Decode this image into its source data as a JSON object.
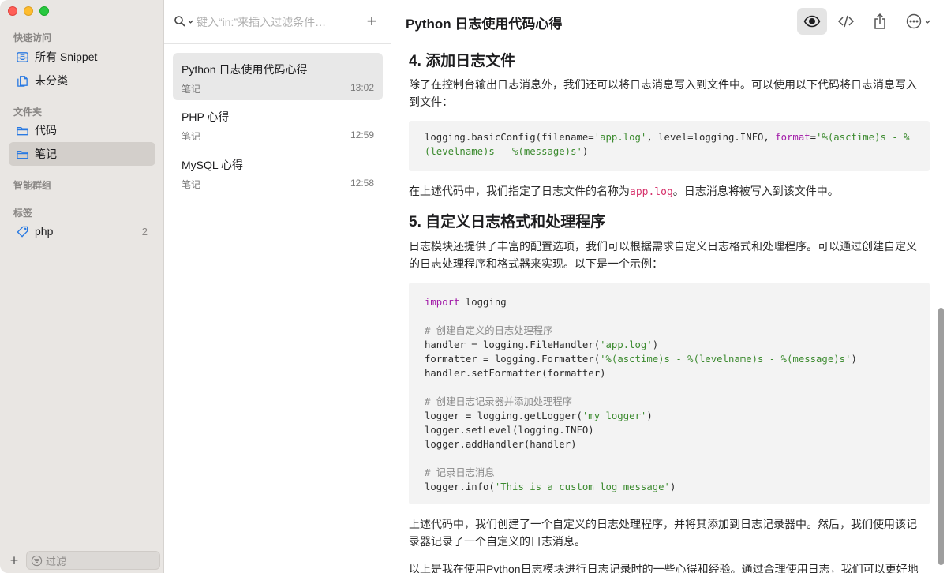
{
  "sidebar": {
    "quick_access_title": "快速访问",
    "quick_access": [
      {
        "label": "所有 Snippet",
        "icon": "tray-icon"
      },
      {
        "label": "未分类",
        "icon": "documents-icon"
      }
    ],
    "folders_title": "文件夹",
    "folders": [
      {
        "label": "代码",
        "icon": "folder-icon",
        "active": false
      },
      {
        "label": "笔记",
        "icon": "folder-icon",
        "active": true
      }
    ],
    "smart_groups_title": "智能群组",
    "tags_title": "标签",
    "tags": [
      {
        "label": "php",
        "count": "2",
        "icon": "tag-icon"
      }
    ],
    "add_label": "+",
    "filter_placeholder": "过滤"
  },
  "list": {
    "search_placeholder": "键入“in:”来插入过滤条件…",
    "add_label": "+",
    "notes": [
      {
        "title": "Python 日志使用代码心得",
        "folder": "笔记",
        "time": "13:02",
        "selected": true
      },
      {
        "title": "PHP 心得",
        "folder": "笔记",
        "time": "12:59",
        "selected": false
      },
      {
        "title": "MySQL 心得",
        "folder": "笔记",
        "time": "12:58",
        "selected": false
      }
    ]
  },
  "main": {
    "title": "Python 日志使用代码心得",
    "toolbar": [
      "eye-icon",
      "code-icon",
      "share-icon",
      "more-icon"
    ],
    "h4": "4. 添加日志文件",
    "p1": "除了在控制台输出日志消息外，我们还可以将日志消息写入到文件中。可以使用以下代码将日志消息写入到文件：",
    "code1_a": "logging.basicConfig(filename=",
    "code1_b": "'app.log'",
    "code1_c": ", level=logging.INFO, ",
    "code1_d": "format",
    "code1_e": "=",
    "code1_f": "'%(asctime)s - %(levelname)s - %(message)s'",
    "code1_g": ")",
    "p2_a": "在上述代码中，我们指定了日志文件的名称为",
    "p2_code": "app.log",
    "p2_b": "。日志消息将被写入到该文件中。",
    "h5": "5. 自定义日志格式和处理程序",
    "p3": "日志模块还提供了丰富的配置选项，我们可以根据需求自定义日志格式和处理程序。可以通过创建自定义的日志处理程序和格式器来实现。以下是一个示例：",
    "code2": {
      "l1_kw": "import",
      "l1_rest": " logging",
      "l3": "# 创建自定义的日志处理程序",
      "l4_a": "handler = logging.FileHandler(",
      "l4_s": "'app.log'",
      "l4_b": ")",
      "l5_a": "formatter = logging.Formatter(",
      "l5_s": "'%(asctime)s - %(levelname)s - %(message)s'",
      "l5_b": ")",
      "l6": "handler.setFormatter(formatter)",
      "l8": "# 创建日志记录器并添加处理程序",
      "l9_a": "logger = logging.getLogger(",
      "l9_s": "'my_logger'",
      "l9_b": ")",
      "l10": "logger.setLevel(logging.INFO)",
      "l11": "logger.addHandler(handler)",
      "l13": "# 记录日志消息",
      "l14_a": "logger.info(",
      "l14_s": "'This is a custom log message'",
      "l14_b": ")"
    },
    "p4": "上述代码中，我们创建了一个自定义的日志处理程序，并将其添加到日志记录器中。然后，我们使用该记录器记录了一个自定义的日志消息。",
    "p5": "以上是我在使用Python日志模块进行日志记录时的一些心得和经验。通过合理使用日志，我们可以更好地"
  }
}
